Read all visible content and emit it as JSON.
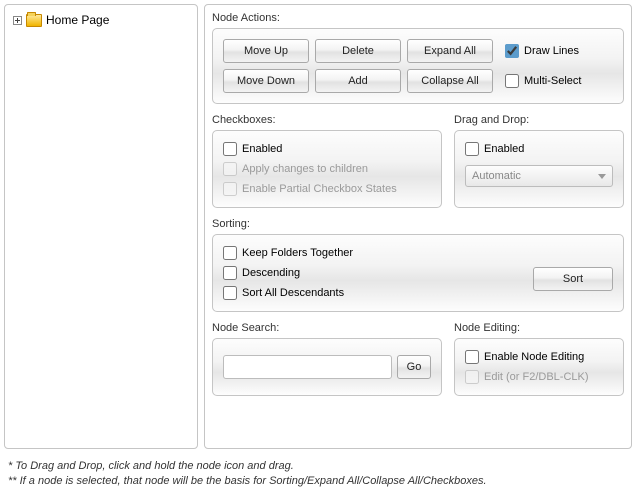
{
  "tree": {
    "root_label": "Home Page"
  },
  "node_actions": {
    "title": "Node Actions:",
    "move_up": "Move Up",
    "move_down": "Move Down",
    "delete": "Delete",
    "add": "Add",
    "expand_all": "Expand All",
    "collapse_all": "Collapse All",
    "draw_lines_label": "Draw Lines",
    "draw_lines_checked": true,
    "multi_select_label": "Multi-Select",
    "multi_select_checked": false
  },
  "checkboxes_group": {
    "title": "Checkboxes:",
    "enabled_label": "Enabled",
    "enabled_checked": false,
    "apply_children_label": "Apply changes to children",
    "apply_children_checked": false,
    "partial_label": "Enable Partial Checkbox States",
    "partial_checked": false
  },
  "dragdrop": {
    "title": "Drag and Drop:",
    "enabled_label": "Enabled",
    "enabled_checked": false,
    "mode_selected": "Automatic"
  },
  "sorting": {
    "title": "Sorting:",
    "keep_folders_label": "Keep Folders Together",
    "keep_folders_checked": false,
    "descending_label": "Descending",
    "descending_checked": false,
    "sort_all_label": "Sort All Descendants",
    "sort_all_checked": false,
    "sort_button": "Sort"
  },
  "search": {
    "title": "Node Search:",
    "value": "",
    "go": "Go"
  },
  "editing": {
    "title": "Node Editing:",
    "enable_label": "Enable Node Editing",
    "enable_checked": false,
    "edit_label": "Edit (or F2/DBL-CLK)",
    "edit_checked": false
  },
  "footer": {
    "line1": "* To Drag and Drop, click and hold the node icon and drag.",
    "line2": "** If a node is selected, that node will be the basis for Sorting/Expand All/Collapse All/Checkboxes."
  }
}
